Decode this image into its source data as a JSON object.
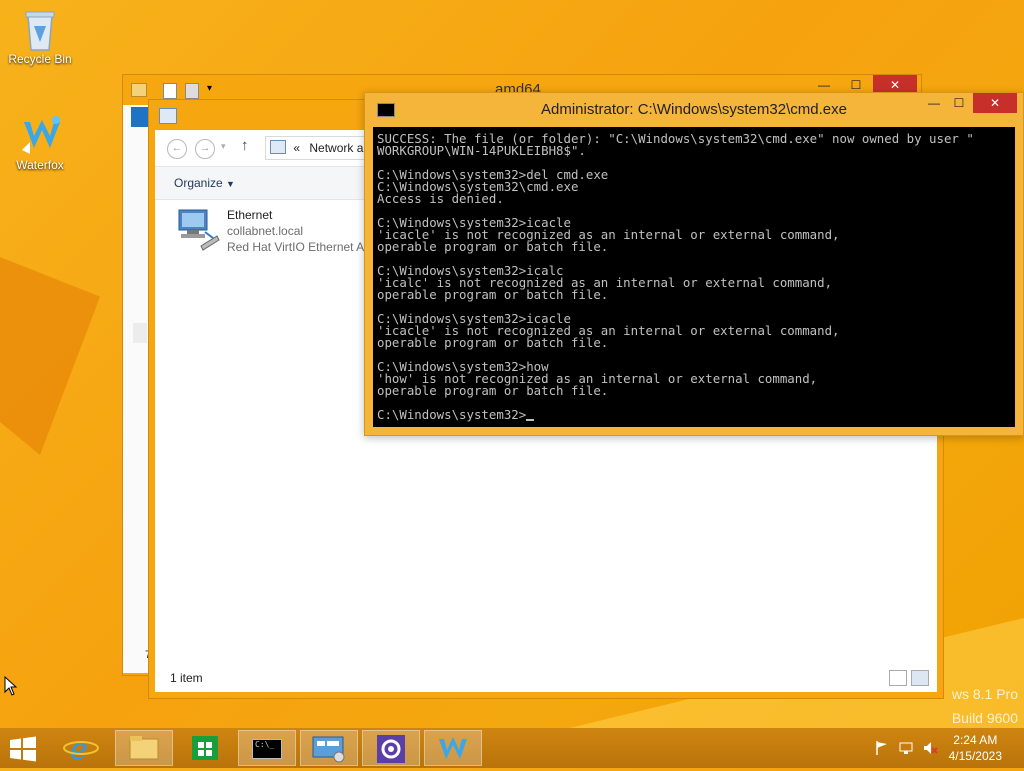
{
  "desktop": {
    "icons": [
      {
        "label": "Recycle Bin"
      },
      {
        "label": "Waterfox"
      }
    ],
    "watermark": {
      "line1": "ws 8.1 Pro",
      "line2": "Build 9600"
    }
  },
  "explorer_back": {
    "title": "amd64",
    "side_marker": "7"
  },
  "explorer_front": {
    "address_prefix": "«",
    "address_text": "Network an",
    "organize_label": "Organize",
    "item": {
      "name": "Ethernet",
      "domain": "collabnet.local",
      "adapter": "Red Hat VirtIO Ethernet Ac"
    },
    "status": "1 item"
  },
  "cmd": {
    "title": "Administrator: C:\\Windows\\system32\\cmd.exe",
    "lines": [
      "SUCCESS: The file (or folder): \"C:\\Windows\\system32\\cmd.exe\" now owned by user \"",
      "WORKGROUP\\WIN-14PUKLEIBH8$\".",
      "",
      "C:\\Windows\\system32>del cmd.exe",
      "C:\\Windows\\system32\\cmd.exe",
      "Access is denied.",
      "",
      "C:\\Windows\\system32>icacle",
      "'icacle' is not recognized as an internal or external command,",
      "operable program or batch file.",
      "",
      "C:\\Windows\\system32>icalc",
      "'icalc' is not recognized as an internal or external command,",
      "operable program or batch file.",
      "",
      "C:\\Windows\\system32>icacle",
      "'icacle' is not recognized as an internal or external command,",
      "operable program or batch file.",
      "",
      "C:\\Windows\\system32>how",
      "'how' is not recognized as an internal or external command,",
      "operable program or batch file.",
      "",
      "C:\\Windows\\system32>"
    ]
  },
  "window_buttons": {
    "minimize": "—",
    "maximize": "☐",
    "close": "✕"
  },
  "taskbar": {
    "apps": [
      {
        "icon": "internet-explorer-icon"
      },
      {
        "icon": "file-explorer-icon"
      },
      {
        "icon": "store-icon"
      },
      {
        "icon": "cmd-icon"
      },
      {
        "icon": "network-monitor-icon"
      },
      {
        "icon": "settings-icon"
      },
      {
        "icon": "waterfox-icon"
      }
    ],
    "cmd_icon_text": "C:\\_",
    "clock": {
      "time": "2:24 AM",
      "date": "4/15/2023"
    }
  },
  "colors": {
    "accent": "#f6a60f",
    "close_button": "#c7302a",
    "console_bg": "#000000",
    "console_text": "#c0c0c0"
  }
}
